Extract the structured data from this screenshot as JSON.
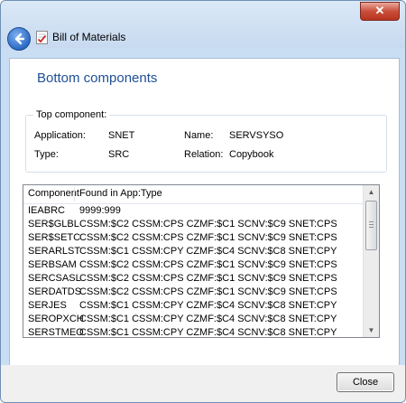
{
  "window": {
    "title": "Bill of Materials",
    "close_glyph": "✕"
  },
  "page": {
    "heading": "Bottom components"
  },
  "top_component": {
    "legend": "Top component:",
    "application_label": "Application:",
    "application_value": "SNET",
    "name_label": "Name:",
    "name_value": "SERVSYSO",
    "type_label": "Type:",
    "type_value": "SRC",
    "relation_label": "Relation:",
    "relation_value": "Copybook"
  },
  "list": {
    "columns": [
      "Component",
      "Found in App:Type"
    ],
    "rows": [
      {
        "component": "IEABRC",
        "found": "9999:999"
      },
      {
        "component": "SER$GLBL",
        "found": "CSSM:$C2 CSSM:CPS CZMF:$C1 SCNV:$C9 SNET:CPS"
      },
      {
        "component": "SER$SETC",
        "found": "CSSM:$C2 CSSM:CPS CZMF:$C1 SCNV:$C9 SNET:CPS"
      },
      {
        "component": "SERARLST",
        "found": "CSSM:$C1 CSSM:CPY CZMF:$C4 SCNV:$C8 SNET:CPY"
      },
      {
        "component": "SERBSAM",
        "found": "CSSM:$C2 CSSM:CPS CZMF:$C1 SCNV:$C9 SNET:CPS"
      },
      {
        "component": "SERCSASL",
        "found": "CSSM:$C2 CSSM:CPS CZMF:$C1 SCNV:$C9 SNET:CPS"
      },
      {
        "component": "SERDATDS",
        "found": "CSSM:$C2 CSSM:CPS CZMF:$C1 SCNV:$C9 SNET:CPS"
      },
      {
        "component": "SERJES",
        "found": "CSSM:$C1 CSSM:CPY CZMF:$C4 SCNV:$C8 SNET:CPY"
      },
      {
        "component": "SEROPXCH",
        "found": "CSSM:$C1 CSSM:CPY CZMF:$C4 SCNV:$C8 SNET:CPY"
      },
      {
        "component": "SERSTMEO",
        "found": "CSSM:$C1 CSSM:CPY CZMF:$C4 SCNV:$C8 SNET:CPY"
      }
    ],
    "scroll_up_glyph": "▲",
    "scroll_down_glyph": "▼"
  },
  "footer": {
    "close_label": "Close"
  },
  "icons": {
    "back": "back-arrow-icon",
    "document": "document-check-icon"
  },
  "colors": {
    "heading": "#1e4f96",
    "titlebar": "#c9ddf3",
    "close_button": "#c94f3a"
  }
}
